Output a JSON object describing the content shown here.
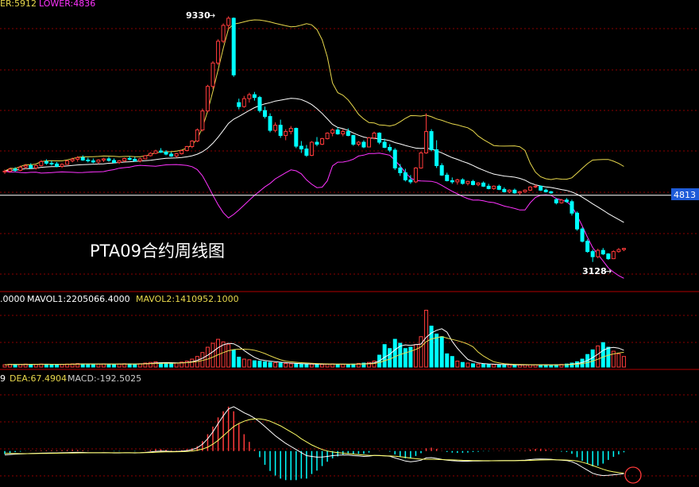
{
  "header": {
    "boll_upper": "ER:5912",
    "boll_lower": "LOWER:4836",
    "vol_mavol0": ".0000",
    "vol_mavol1": "MAVOL1:2205066.4000",
    "vol_mavol2": "MAVOL2:1410952.1000",
    "macd_dif": "9",
    "macd_dea": "DEA:67.4904",
    "macd_val": "MACD:-192.5025"
  },
  "annotations": {
    "title": "PTA09合约周线图",
    "high_label": "9330",
    "low_label": "3128",
    "price_tag": "4813"
  },
  "colors": {
    "up": "#ff3b3b",
    "down": "#00ffff",
    "boll_upper": "#e8d84c",
    "boll_mid": "#ffffff",
    "boll_lower": "#ff33ff",
    "grid": "#8b0000",
    "panel_border": "#b00000",
    "dif": "#ffffff",
    "dea": "#ffff66",
    "tag_bg": "#1e5bd8"
  },
  "chart_data": {
    "type": "candlestick",
    "x_unit": "week",
    "y_range": [
      2400,
      9500
    ],
    "tag_price": 4813,
    "candles": [
      [
        5400,
        5460,
        5350,
        5420
      ],
      [
        5420,
        5500,
        5380,
        5470
      ],
      [
        5470,
        5520,
        5400,
        5440
      ],
      [
        5440,
        5560,
        5420,
        5520
      ],
      [
        5520,
        5600,
        5480,
        5560
      ],
      [
        5560,
        5620,
        5480,
        5500
      ],
      [
        5500,
        5580,
        5460,
        5560
      ],
      [
        5560,
        5700,
        5540,
        5660
      ],
      [
        5660,
        5720,
        5580,
        5620
      ],
      [
        5620,
        5680,
        5560,
        5600
      ],
      [
        5600,
        5650,
        5520,
        5540
      ],
      [
        5540,
        5620,
        5500,
        5590
      ],
      [
        5590,
        5700,
        5580,
        5680
      ],
      [
        5680,
        5760,
        5640,
        5720
      ],
      [
        5720,
        5800,
        5660,
        5760
      ],
      [
        5760,
        5820,
        5680,
        5700
      ],
      [
        5700,
        5760,
        5640,
        5680
      ],
      [
        5680,
        5740,
        5620,
        5650
      ],
      [
        5650,
        5720,
        5600,
        5700
      ],
      [
        5700,
        5760,
        5650,
        5730
      ],
      [
        5730,
        5780,
        5660,
        5690
      ],
      [
        5690,
        5740,
        5620,
        5640
      ],
      [
        5640,
        5700,
        5600,
        5680
      ],
      [
        5680,
        5760,
        5650,
        5740
      ],
      [
        5740,
        5800,
        5690,
        5720
      ],
      [
        5720,
        5780,
        5660,
        5680
      ],
      [
        5680,
        5760,
        5640,
        5730
      ],
      [
        5730,
        5830,
        5720,
        5810
      ],
      [
        5810,
        5900,
        5790,
        5870
      ],
      [
        5870,
        5960,
        5850,
        5930
      ],
      [
        5930,
        6000,
        5880,
        5900
      ],
      [
        5900,
        5950,
        5820,
        5850
      ],
      [
        5850,
        5900,
        5780,
        5800
      ],
      [
        5800,
        5880,
        5760,
        5860
      ],
      [
        5860,
        5960,
        5840,
        5940
      ],
      [
        5940,
        6060,
        5920,
        6040
      ],
      [
        6040,
        6200,
        6000,
        6180
      ],
      [
        6180,
        6500,
        6150,
        6460
      ],
      [
        6460,
        7000,
        6420,
        6940
      ],
      [
        6940,
        7600,
        6900,
        7560
      ],
      [
        7560,
        8200,
        7500,
        8150
      ],
      [
        8150,
        8750,
        8100,
        8700
      ],
      [
        8700,
        9150,
        8650,
        9100
      ],
      [
        9100,
        9330,
        9000,
        9280
      ],
      [
        9280,
        9300,
        7800,
        7850
      ],
      [
        7150,
        7250,
        6980,
        7050
      ],
      [
        7050,
        7320,
        7020,
        7250
      ],
      [
        7250,
        7400,
        7150,
        7350
      ],
      [
        7350,
        7420,
        7200,
        7280
      ],
      [
        7280,
        7320,
        6900,
        6950
      ],
      [
        6950,
        7050,
        6750,
        6800
      ],
      [
        6800,
        6880,
        6400,
        6450
      ],
      [
        6450,
        6650,
        6400,
        6580
      ],
      [
        6580,
        6720,
        6260,
        6320
      ],
      [
        6320,
        6480,
        6200,
        6420
      ],
      [
        6420,
        6560,
        6350,
        6500
      ],
      [
        6500,
        6520,
        6000,
        6050
      ],
      [
        6050,
        6180,
        5880,
        5980
      ],
      [
        5980,
        6080,
        5780,
        5820
      ],
      [
        5820,
        6180,
        5800,
        6150
      ],
      [
        6150,
        6280,
        6050,
        6100
      ],
      [
        6100,
        6260,
        6080,
        6240
      ],
      [
        6240,
        6400,
        6220,
        6380
      ],
      [
        6380,
        6500,
        6300,
        6460
      ],
      [
        6460,
        6520,
        6340,
        6360
      ],
      [
        6360,
        6480,
        6300,
        6420
      ],
      [
        6420,
        6500,
        6300,
        6320
      ],
      [
        6320,
        6340,
        6060,
        6100
      ],
      [
        6100,
        6180,
        6050,
        6150
      ],
      [
        6150,
        6200,
        6000,
        6030
      ],
      [
        6030,
        6280,
        6020,
        6260
      ],
      [
        6260,
        6420,
        6220,
        6380
      ],
      [
        6380,
        6400,
        6100,
        6150
      ],
      [
        6150,
        6240,
        6000,
        6020
      ],
      [
        6020,
        6100,
        5900,
        5950
      ],
      [
        5950,
        6000,
        5450,
        5500
      ],
      [
        5500,
        5600,
        5300,
        5380
      ],
      [
        5380,
        5480,
        5160,
        5200
      ],
      [
        5200,
        5320,
        5100,
        5150
      ],
      [
        5150,
        5520,
        5120,
        5500
      ],
      [
        5500,
        5920,
        5480,
        5880
      ],
      [
        5880,
        6880,
        5860,
        6420
      ],
      [
        6420,
        6480,
        5920,
        5960
      ],
      [
        5960,
        6200,
        5500,
        5560
      ],
      [
        5560,
        5620,
        5300,
        5320
      ],
      [
        5320,
        5380,
        5160,
        5180
      ],
      [
        5180,
        5260,
        5100,
        5150
      ],
      [
        5150,
        5230,
        5080,
        5200
      ],
      [
        5200,
        5240,
        5080,
        5110
      ],
      [
        5110,
        5180,
        5060,
        5160
      ],
      [
        5160,
        5200,
        5060,
        5080
      ],
      [
        5080,
        5140,
        5040,
        5120
      ],
      [
        5120,
        5160,
        5020,
        5040
      ],
      [
        5040,
        5100,
        4960,
        4980
      ],
      [
        4980,
        5060,
        4950,
        5040
      ],
      [
        5040,
        5080,
        4940,
        4960
      ],
      [
        4960,
        5010,
        4880,
        4900
      ],
      [
        4900,
        4960,
        4860,
        4940
      ],
      [
        4940,
        4980,
        4850,
        4870
      ],
      [
        4870,
        4920,
        4820,
        4900
      ],
      [
        4900,
        4960,
        4880,
        4940
      ],
      [
        4940,
        5040,
        4920,
        5020
      ],
      [
        5020,
        5080,
        4990,
        5040
      ],
      [
        5040,
        5060,
        4920,
        4940
      ],
      [
        4940,
        4980,
        4880,
        4900
      ],
      [
        4900,
        4920,
        4850,
        4870
      ],
      [
        4700,
        4740,
        4580,
        4620
      ],
      [
        4620,
        4720,
        4600,
        4690
      ],
      [
        4690,
        4740,
        4620,
        4650
      ],
      [
        4650,
        4700,
        4300,
        4360
      ],
      [
        4360,
        4400,
        3920,
        3960
      ],
      [
        3960,
        4000,
        3620,
        3650
      ],
      [
        3650,
        3700,
        3360,
        3390
      ],
      [
        3390,
        3440,
        3128,
        3260
      ],
      [
        3260,
        3460,
        3220,
        3420
      ],
      [
        3420,
        3480,
        3300,
        3330
      ],
      [
        3330,
        3350,
        3180,
        3210
      ],
      [
        3210,
        3420,
        3200,
        3390
      ],
      [
        3390,
        3480,
        3360,
        3440
      ],
      [
        3440,
        3480,
        3400,
        3470
      ]
    ],
    "volume_range": [
      0,
      950000
    ],
    "volume": [
      35000,
      42000,
      38000,
      40000,
      45000,
      42000,
      40000,
      46000,
      42000,
      40000,
      38000,
      42000,
      45000,
      48000,
      52000,
      46000,
      44000,
      42000,
      45000,
      48000,
      44000,
      42000,
      46000,
      50000,
      48000,
      45000,
      50000,
      60000,
      70000,
      80000,
      65000,
      60000,
      55000,
      60000,
      75000,
      90000,
      120000,
      160000,
      220000,
      300000,
      360000,
      420000,
      380000,
      340000,
      260000,
      150000,
      120000,
      110000,
      95000,
      90000,
      80000,
      70000,
      65000,
      60000,
      55000,
      50000,
      48000,
      46000,
      44000,
      45000,
      42000,
      40000,
      44000,
      48000,
      42000,
      40000,
      41000,
      45000,
      55000,
      60000,
      70000,
      90000,
      180000,
      340000,
      280000,
      420000,
      360000,
      280000,
      300000,
      340000,
      460000,
      860000,
      620000,
      500000,
      460000,
      200000,
      160000,
      90000,
      70000,
      60000,
      50000,
      45000,
      42000,
      40000,
      38000,
      36000,
      35000,
      34000,
      33000,
      32000,
      34000,
      36000,
      35000,
      34000,
      33000,
      32000,
      36000,
      40000,
      46000,
      60000,
      80000,
      120000,
      190000,
      260000,
      320000,
      370000,
      300000,
      240000,
      200000,
      160000
    ],
    "macd_range": [
      -470,
      880
    ],
    "dif": [
      -50,
      -45,
      -40,
      -38,
      -35,
      -32,
      -30,
      -28,
      -26,
      -25,
      -24,
      -22,
      -20,
      -18,
      -17,
      -18,
      -20,
      -22,
      -22,
      -21,
      -22,
      -24,
      -24,
      -22,
      -22,
      -24,
      -22,
      -18,
      -12,
      -4,
      0,
      -2,
      -6,
      -6,
      -2,
      6,
      18,
      42,
      90,
      160,
      250,
      360,
      460,
      550,
      580,
      540,
      500,
      470,
      430,
      380,
      320,
      260,
      200,
      150,
      100,
      60,
      20,
      -20,
      -60,
      -70,
      -80,
      -78,
      -70,
      -60,
      -55,
      -50,
      -52,
      -60,
      -64,
      -70,
      -66,
      -58,
      -58,
      -62,
      -68,
      -90,
      -110,
      -130,
      -140,
      -132,
      -120,
      -90,
      -86,
      -96,
      -110,
      -120,
      -126,
      -130,
      -132,
      -132,
      -130,
      -130,
      -128,
      -128,
      -126,
      -125,
      -124,
      -124,
      -124,
      -122,
      -120,
      -112,
      -105,
      -104,
      -106,
      -108,
      -116,
      -120,
      -124,
      -140,
      -170,
      -210,
      -250,
      -290,
      -310,
      -320,
      -316,
      -310,
      -304,
      -296
    ],
    "dea": [
      -30,
      -32,
      -33,
      -34,
      -34,
      -34,
      -33,
      -32,
      -31,
      -30,
      -29,
      -28,
      -27,
      -26,
      -24,
      -23,
      -23,
      -22,
      -22,
      -22,
      -22,
      -22,
      -22,
      -22,
      -22,
      -22,
      -22,
      -21,
      -19,
      -16,
      -13,
      -11,
      -10,
      -9,
      -8,
      -5,
      0,
      10,
      25,
      50,
      90,
      140,
      200,
      260,
      320,
      360,
      390,
      410,
      420,
      420,
      410,
      390,
      360,
      330,
      290,
      250,
      210,
      160,
      120,
      80,
      48,
      20,
      0,
      -12,
      -20,
      -28,
      -34,
      -40,
      -46,
      -52,
      -56,
      -58,
      -60,
      -62,
      -64,
      -68,
      -74,
      -82,
      -92,
      -100,
      -106,
      -108,
      -108,
      -110,
      -112,
      -114,
      -116,
      -118,
      -121,
      -122,
      -124,
      -125,
      -126,
      -126,
      -127,
      -127,
      -126,
      -126,
      -126,
      -125,
      -124,
      -122,
      -119,
      -117,
      -116,
      -114,
      -115,
      -116,
      -118,
      -122,
      -130,
      -146,
      -166,
      -190,
      -214,
      -238,
      -258,
      -272,
      -282,
      -288
    ]
  }
}
